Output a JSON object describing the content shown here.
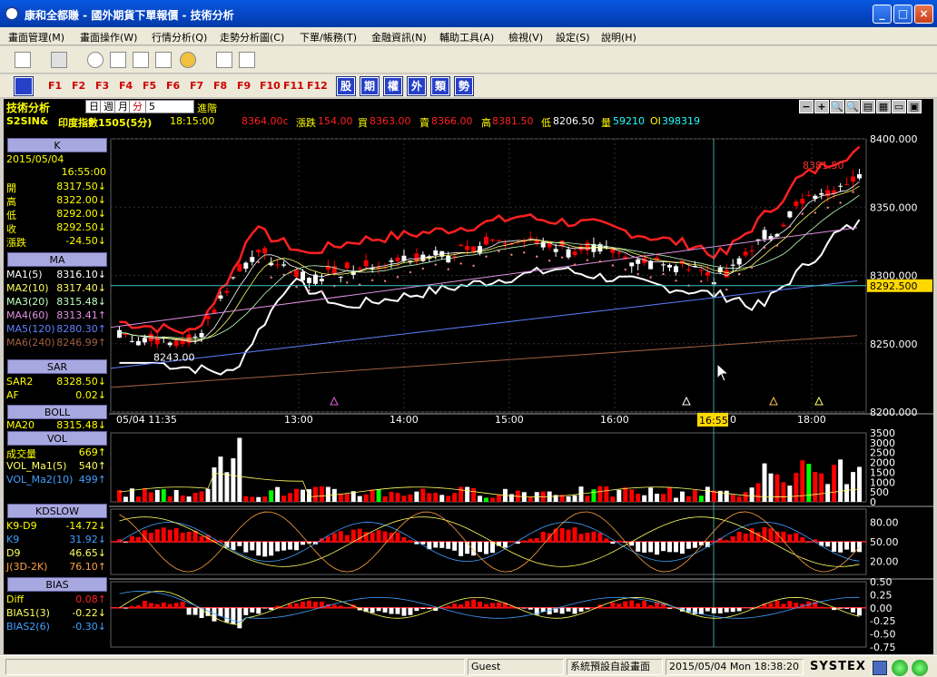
{
  "window": {
    "title": "康和全都賺 - 國外期貨下單報價 - 技術分析",
    "controls": {
      "minimize": "_",
      "maximize": "□",
      "close": "×"
    }
  },
  "menu": [
    "畫面管理(M)",
    "畫面操作(W)",
    "行情分析(Q)",
    "走勢分析圖(C)",
    "下單/帳務(T)",
    "金融資訊(N)",
    "輔助工具(A)",
    "檢視(V)",
    "設定(S)",
    "說明(H)"
  ],
  "fkeys": [
    "F1",
    "F2",
    "F3",
    "F4",
    "F5",
    "F6",
    "F7",
    "F8",
    "F9",
    "F10",
    "F11",
    "F12"
  ],
  "quick_buttons": [
    "股",
    "期",
    "權",
    "外",
    "類",
    "勢"
  ],
  "chart": {
    "title": "技術分析",
    "period_options": [
      "日",
      "週",
      "月",
      "分"
    ],
    "period_value": "5",
    "advanced_label": "進階",
    "controls": [
      "−",
      "+",
      "🔍",
      "🔍",
      "▤",
      "▦",
      "▭",
      "▣"
    ]
  },
  "quote": {
    "symbol": "S2SIN&",
    "name": "印度指數1505(5分)",
    "time": "18:15:00",
    "last": "8364.00c",
    "change_label": "漲跌",
    "change": "154.00",
    "bid_label": "買",
    "bid": "8363.00",
    "ask_label": "賣",
    "ask": "8366.00",
    "high_label": "高",
    "high": "8381.50",
    "low_label": "低",
    "low": "8206.50",
    "vol_label": "量",
    "vol": "59210",
    "oi_label": "OI",
    "oi": "398319"
  },
  "panel": {
    "k": {
      "head": "K",
      "date": "2015/05/04",
      "time": "16:55:00",
      "rows": [
        {
          "label": "開",
          "value": "8317.50↓"
        },
        {
          "label": "高",
          "value": "8322.00↓"
        },
        {
          "label": "低",
          "value": "8292.00↓"
        },
        {
          "label": "收",
          "value": "8292.50↓"
        },
        {
          "label": "漲跌",
          "value": "-24.50↓"
        }
      ]
    },
    "ma": {
      "head": "MA",
      "rows": [
        {
          "label": "MA1(5)",
          "value": "8316.10↓"
        },
        {
          "label": "MA2(10)",
          "value": "8317.40↓"
        },
        {
          "label": "MA3(20)",
          "value": "8315.48↓"
        },
        {
          "label": "MA4(60)",
          "value": "8313.41↑"
        },
        {
          "label": "MA5(120)",
          "value": "8280.30↑"
        },
        {
          "label": "MA6(240)",
          "value": "8246.99↑"
        }
      ]
    },
    "sar": {
      "head": "SAR",
      "rows": [
        {
          "label": "SAR2",
          "value": "8328.50↓"
        },
        {
          "label": "AF",
          "value": "0.02↓"
        }
      ]
    },
    "boll": {
      "head": "BOLL",
      "rows": [
        {
          "label": "MA20",
          "value": "8315.48↓"
        }
      ]
    },
    "vol": {
      "head": "VOL",
      "rows": [
        {
          "label": "成交量",
          "value": "669↑"
        },
        {
          "label": "VOL_Ma1(5)",
          "value": "540↑"
        },
        {
          "label": "VOL_Ma2(10)",
          "value": "499↑"
        }
      ]
    },
    "kd": {
      "head": "KDSLOW",
      "rows": [
        {
          "label": "K9-D9",
          "value": "-14.72↓"
        },
        {
          "label": "K9",
          "value": "31.92↓"
        },
        {
          "label": "D9",
          "value": "46.65↓"
        },
        {
          "label": "J(3D-2K)",
          "value": "76.10↑"
        }
      ]
    },
    "bias": {
      "head": "BIAS",
      "rows": [
        {
          "label": "Diff",
          "value": "0.08↑"
        },
        {
          "label": "BIAS1(3)",
          "value": "-0.22↓"
        },
        {
          "label": "BIAS2(6)",
          "value": "-0.30↓"
        }
      ]
    }
  },
  "axes": {
    "price_ticks": [
      "8400.000",
      "8350.000",
      "8300.000",
      "8250.000",
      "8200.000"
    ],
    "current_price": "8292.500",
    "time_ticks": [
      "05/04 11:35",
      "13:00",
      "14:00",
      "15:00",
      "16:00",
      "18:00"
    ],
    "cursor_time": "16:55",
    "cursor_time_tail": "0",
    "hi_label": "8381.50",
    "lo_label": "8243.00",
    "vol_ticks": [
      "3500",
      "3000",
      "2500",
      "2000",
      "1500",
      "1000",
      "500",
      "0"
    ],
    "kd_ticks": [
      "80.00",
      "50.00",
      "20.00"
    ],
    "bias_ticks": [
      "0.50",
      "0.25",
      "0.00",
      "-0.25",
      "-0.50",
      "-0.75"
    ]
  },
  "chart_data": {
    "type": "candlestick",
    "price_ylim": [
      8200,
      8400
    ],
    "current_price": 8292.5,
    "high": 8381.5,
    "low": 8243.0,
    "last_close": 8364.0
  },
  "status": {
    "user": "Guest",
    "screen": "系統預設自設畫面",
    "datetime": "2015/05/04 Mon 18:38:20",
    "brand": "SYSTEX"
  },
  "colors": {
    "up": "#ff0000",
    "down": "#ffffff",
    "grid": "#303030",
    "cursor_highlight": "#ffd800"
  }
}
